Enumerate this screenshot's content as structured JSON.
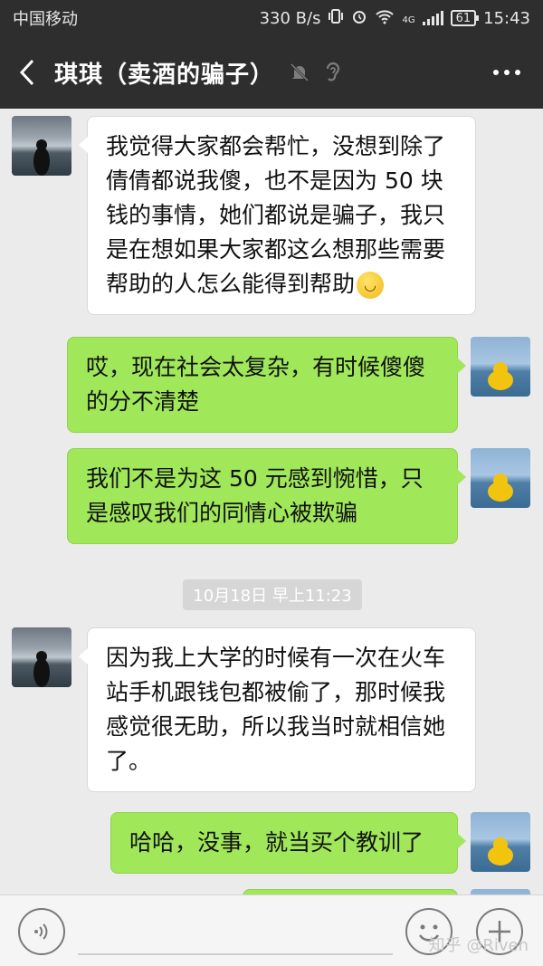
{
  "status_bar": {
    "carrier": "中国移动",
    "speed": "330 B/s",
    "network": "4G",
    "battery": "61",
    "time": "15:43"
  },
  "header": {
    "back_icon": "chevron-left-icon",
    "title": "琪琪（卖酒的骗子）",
    "mute_icon": "bell-slash-icon",
    "voice_icon": "ear-icon",
    "more_icon": "more-dots-icon"
  },
  "messages": [
    {
      "side": "left",
      "text": "我觉得大家都会帮忙，没想到除了倩倩都说我傻，也不是因为 50 块钱的事情，她们都说是骗子，我只是在想如果大家都这么想那些需要帮助的人怎么能得到帮助",
      "emoji": "smile-emoji"
    },
    {
      "side": "right",
      "text": "哎，现在社会太复杂，有时候傻傻的分不清楚"
    },
    {
      "side": "right",
      "text": "我们不是为这 50 元感到惋惜，只是感叹我们的同情心被欺骗"
    },
    {
      "side": "left",
      "text": "因为我上大学的时候有一次在火车站手机跟钱包都被偷了，那时候我感觉很无助，所以我当时就相信她了。"
    },
    {
      "side": "right",
      "text": "哈哈，没事，就当买个教训了"
    }
  ],
  "timestamp": "10月18日 早上11:23",
  "input_bar": {
    "voice_icon": "voice-icon",
    "input_value": "",
    "emoji_icon": "emoji-icon",
    "plus_icon": "plus-icon"
  },
  "watermark": "知乎 @Riven",
  "colors": {
    "header_bg": "#2e2e2e",
    "chat_bg": "#ebebeb",
    "sent_bubble": "#a0e75a",
    "received_bubble": "#ffffff"
  }
}
